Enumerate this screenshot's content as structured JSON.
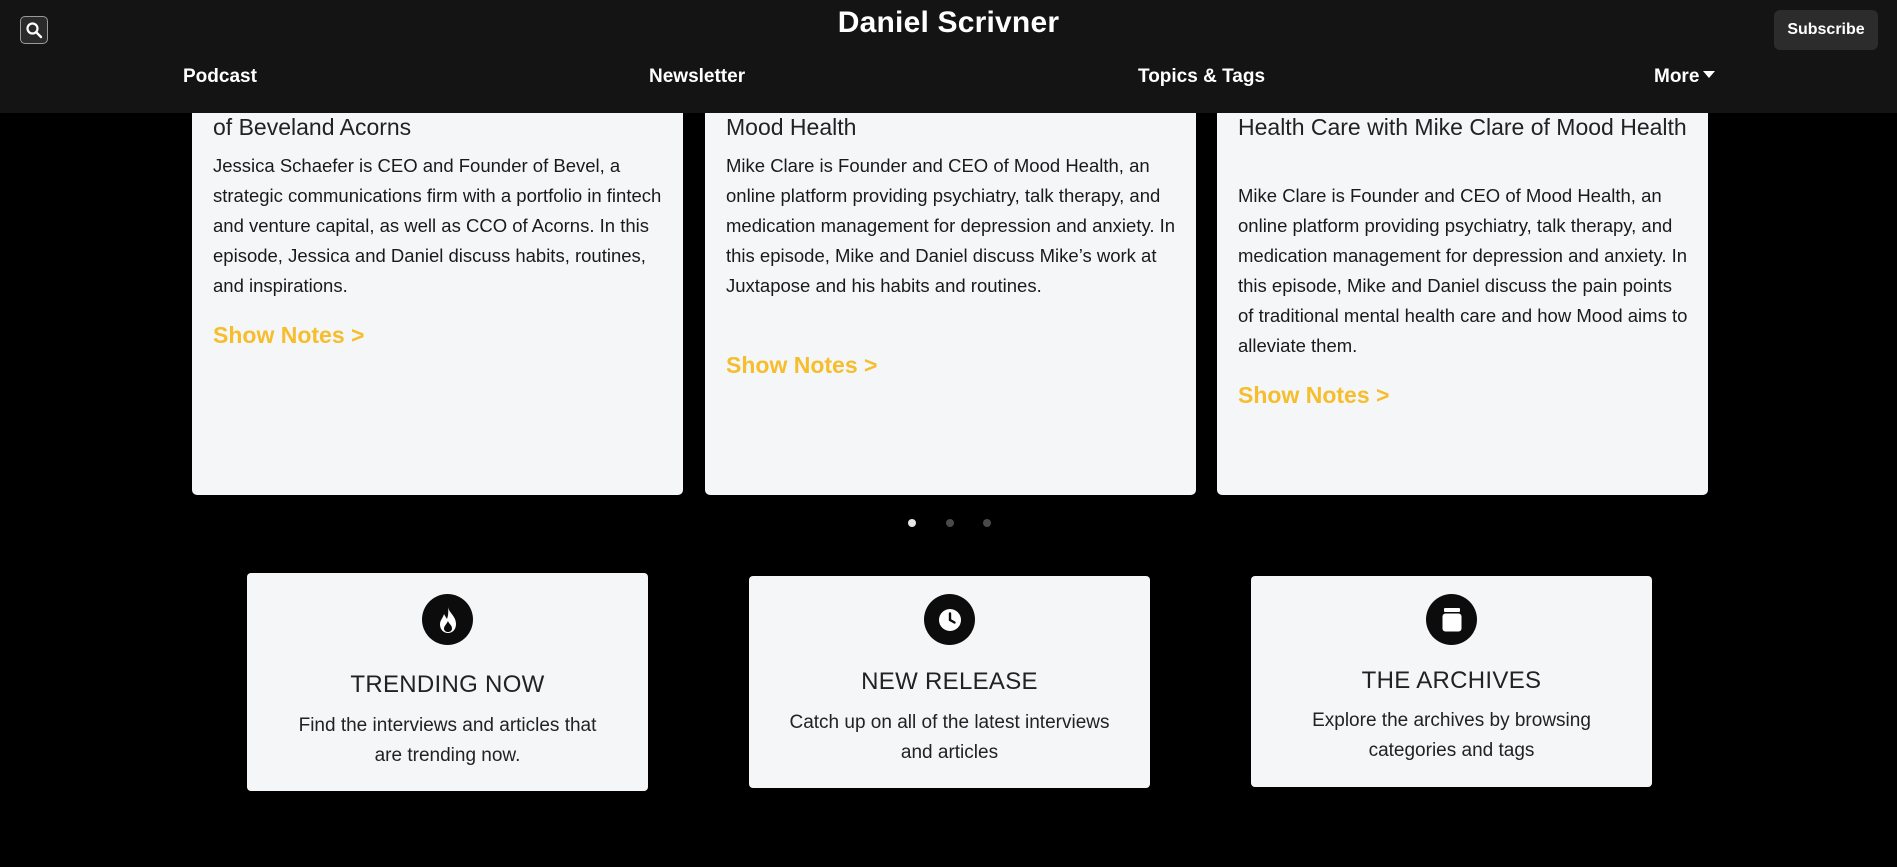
{
  "header": {
    "site_title": "Daniel Scrivner",
    "subscribe_label": "Subscribe",
    "nav": [
      {
        "label": "Podcast"
      },
      {
        "label": "Newsletter"
      },
      {
        "label": "Topics & Tags"
      },
      {
        "label": "More"
      }
    ]
  },
  "episodes": [
    {
      "title": "of Beveland Acorns",
      "description": "Jessica Schaefer is CEO and Founder of Bevel, a strategic communications firm with a portfolio in fintech and venture capital, as well as CCO of Acorns. In this episode, Jessica and Daniel discuss habits, routines, and inspirations.",
      "link_label": "Show Notes >"
    },
    {
      "title": "Mood Health",
      "description": "Mike Clare is Founder and CEO of Mood Health, an online platform providing psychiatry, talk therapy, and medication management for depression and anxiety. In this episode, Mike and Daniel discuss Mike’s work at Juxtapose and his habits and routines.",
      "link_label": "Show Notes >"
    },
    {
      "title": "Health Care with Mike Clare of Mood Health",
      "description": "Mike Clare is Founder and CEO of Mood Health, an online platform providing psychiatry, talk therapy, and medication management for depression and anxiety. In this episode, Mike and Daniel discuss the pain points of traditional mental health care and how Mood aims to alleviate them.",
      "link_label": "Show Notes >"
    }
  ],
  "carousel": {
    "slide_count": 3,
    "active_index": 0
  },
  "features": [
    {
      "icon": "flame-icon",
      "title": "TRENDING NOW",
      "description": "Find the interviews and articles that are trending now."
    },
    {
      "icon": "clock-icon",
      "title": "NEW RELEASE",
      "description": "Catch up on all of the latest interviews and articles"
    },
    {
      "icon": "archive-jar-icon",
      "title": "THE ARCHIVES",
      "description": "Explore the archives by browsing categories and tags"
    }
  ],
  "colors": {
    "accent": "#f6bd2c",
    "card_background": "#f5f6f8",
    "header_background": "#141414",
    "page_background": "#000000"
  }
}
